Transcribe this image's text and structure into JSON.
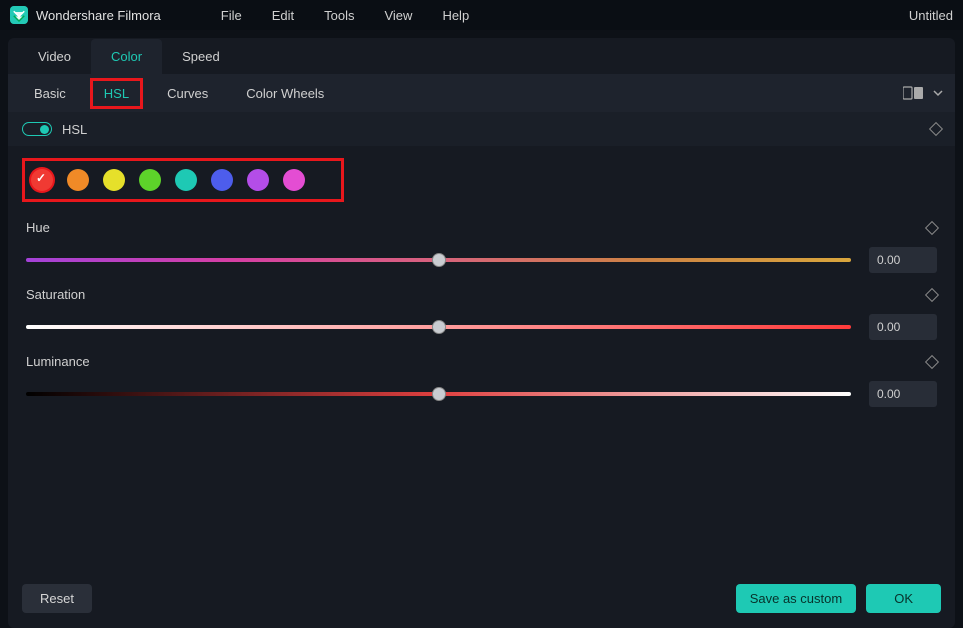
{
  "app_name": "Wondershare Filmora",
  "menu": [
    "File",
    "Edit",
    "Tools",
    "View",
    "Help"
  ],
  "doc_title": "Untitled",
  "main_tabs": {
    "video": "Video",
    "color": "Color",
    "speed": "Speed"
  },
  "sub_tabs": {
    "basic": "Basic",
    "hsl": "HSL",
    "curves": "Curves",
    "wheels": "Color Wheels"
  },
  "section_label": "HSL",
  "swatches": [
    "#f03a33",
    "#f08a27",
    "#e6e02a",
    "#5dd32a",
    "#1ec9b4",
    "#4d5dec",
    "#b44de8",
    "#e44dd3"
  ],
  "sliders": {
    "hue": {
      "label": "Hue",
      "value": "0.00"
    },
    "saturation": {
      "label": "Saturation",
      "value": "0.00"
    },
    "luminance": {
      "label": "Luminance",
      "value": "0.00"
    }
  },
  "buttons": {
    "reset": "Reset",
    "save": "Save as custom",
    "ok": "OK"
  }
}
